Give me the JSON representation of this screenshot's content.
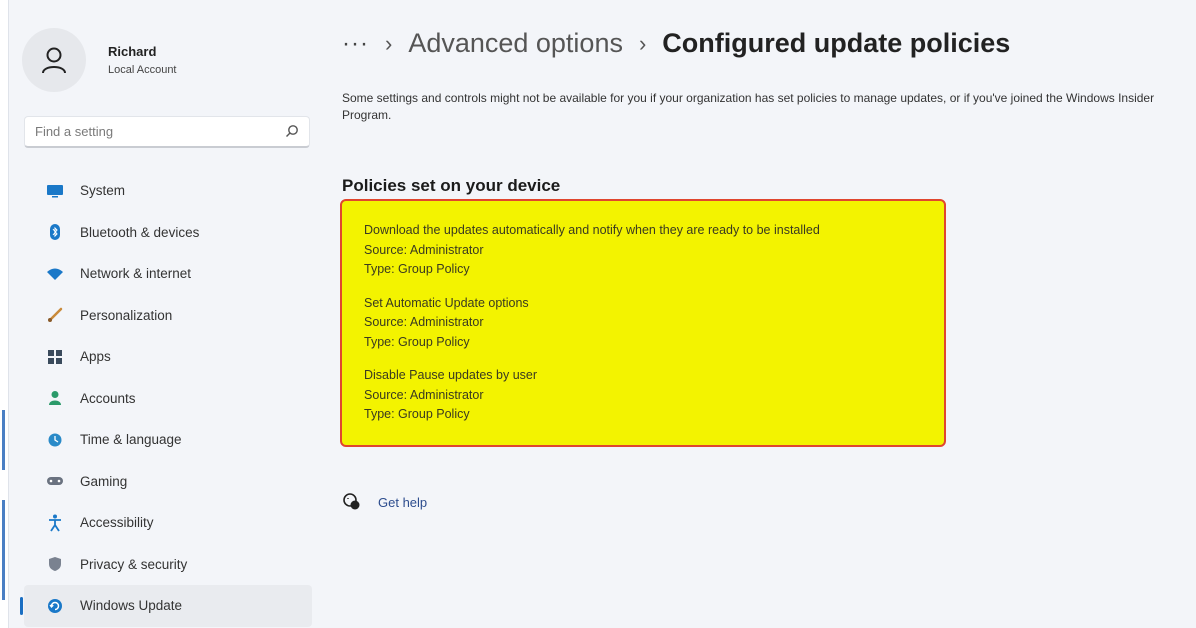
{
  "profile": {
    "name": "Richard",
    "account_type": "Local Account"
  },
  "search": {
    "placeholder": "Find a setting"
  },
  "nav": {
    "items": [
      {
        "label": "System",
        "icon": "monitor-icon"
      },
      {
        "label": "Bluetooth & devices",
        "icon": "bluetooth-icon"
      },
      {
        "label": "Network & internet",
        "icon": "wifi-icon"
      },
      {
        "label": "Personalization",
        "icon": "brush-icon"
      },
      {
        "label": "Apps",
        "icon": "apps-icon"
      },
      {
        "label": "Accounts",
        "icon": "person-icon"
      },
      {
        "label": "Time & language",
        "icon": "globe-clock-icon"
      },
      {
        "label": "Gaming",
        "icon": "gamepad-icon"
      },
      {
        "label": "Accessibility",
        "icon": "accessibility-icon"
      },
      {
        "label": "Privacy & security",
        "icon": "shield-icon"
      },
      {
        "label": "Windows Update",
        "icon": "update-icon",
        "active": true
      }
    ]
  },
  "breadcrumb": {
    "overflow": "···",
    "separator": "›",
    "previous": "Advanced options",
    "current": "Configured update policies"
  },
  "main": {
    "note": "Some settings and controls might not be available for you if your organization has set policies to manage updates, or if you've joined the Windows Insider Program.",
    "section_title": "Policies set on your device",
    "policies": [
      {
        "name": "Download the updates automatically and notify when they are ready to be installed",
        "source": "Source: Administrator",
        "type": "Type: Group Policy"
      },
      {
        "name": "Set Automatic Update options",
        "source": "Source: Administrator",
        "type": "Type: Group Policy"
      },
      {
        "name": "Disable Pause updates by user",
        "source": "Source: Administrator",
        "type": "Type: Group Policy"
      }
    ],
    "help_label": "Get help"
  },
  "colors": {
    "accent": "#1a6ec2",
    "highlight": "#f3f300",
    "highlight_border": "#e0462e",
    "background": "#f3f5f9"
  }
}
